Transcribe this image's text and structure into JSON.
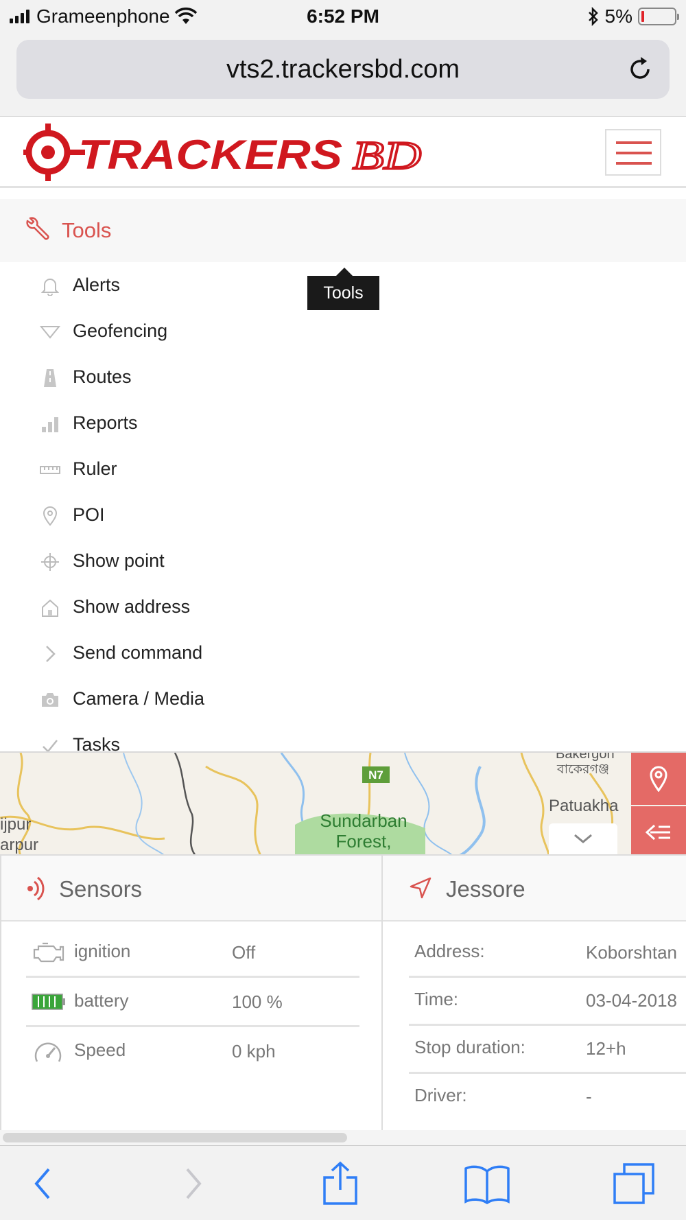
{
  "status_bar": {
    "carrier": "Grameenphone",
    "time": "6:52 PM",
    "battery_percent": "5%",
    "battery_level": 0.05
  },
  "browser": {
    "url": "vts2.trackersbd.com"
  },
  "brand": {
    "logo_text": "TRACKERS BD",
    "accent_color": "#d9534f",
    "logo_color": "#d0181f"
  },
  "tools_menu": {
    "title": "Tools",
    "tooltip": "Tools",
    "items": [
      {
        "label": "Alerts",
        "icon": "bell-icon"
      },
      {
        "label": "Geofencing",
        "icon": "geofence-icon"
      },
      {
        "label": "Routes",
        "icon": "road-icon"
      },
      {
        "label": "Reports",
        "icon": "bar-chart-icon"
      },
      {
        "label": "Ruler",
        "icon": "ruler-icon"
      },
      {
        "label": "POI",
        "icon": "map-pin-icon"
      },
      {
        "label": "Show point",
        "icon": "crosshair-icon"
      },
      {
        "label": "Show address",
        "icon": "home-icon"
      },
      {
        "label": "Send command",
        "icon": "chevron-right-icon"
      },
      {
        "label": "Camera / Media",
        "icon": "camera-icon"
      },
      {
        "label": "Tasks",
        "icon": "check-icon"
      }
    ]
  },
  "map": {
    "labels": {
      "road": "N7",
      "forest_line1": "Sundarban",
      "forest_line2": "Forest,",
      "city_right": "Patuakha",
      "city_top": "Bakergon",
      "city_top_bn": "বাকেরগঞ্জ",
      "city_left1": "ijpur",
      "city_left2": "arpur"
    }
  },
  "sensors": {
    "title": "Sensors",
    "rows": [
      {
        "label": "ignition",
        "value": "Off",
        "icon": "engine-icon"
      },
      {
        "label": "battery",
        "value": "100 %",
        "icon": "battery-icon"
      },
      {
        "label": "Speed",
        "value": "0 kph",
        "icon": "speedometer-icon"
      }
    ]
  },
  "location": {
    "title": "Jessore",
    "rows": [
      {
        "label": "Address:",
        "value": "Koborshtan"
      },
      {
        "label": "Time:",
        "value": "03-04-2018"
      },
      {
        "label": "Stop duration:",
        "value": "12+h"
      },
      {
        "label": "Driver:",
        "value": "-"
      }
    ]
  }
}
